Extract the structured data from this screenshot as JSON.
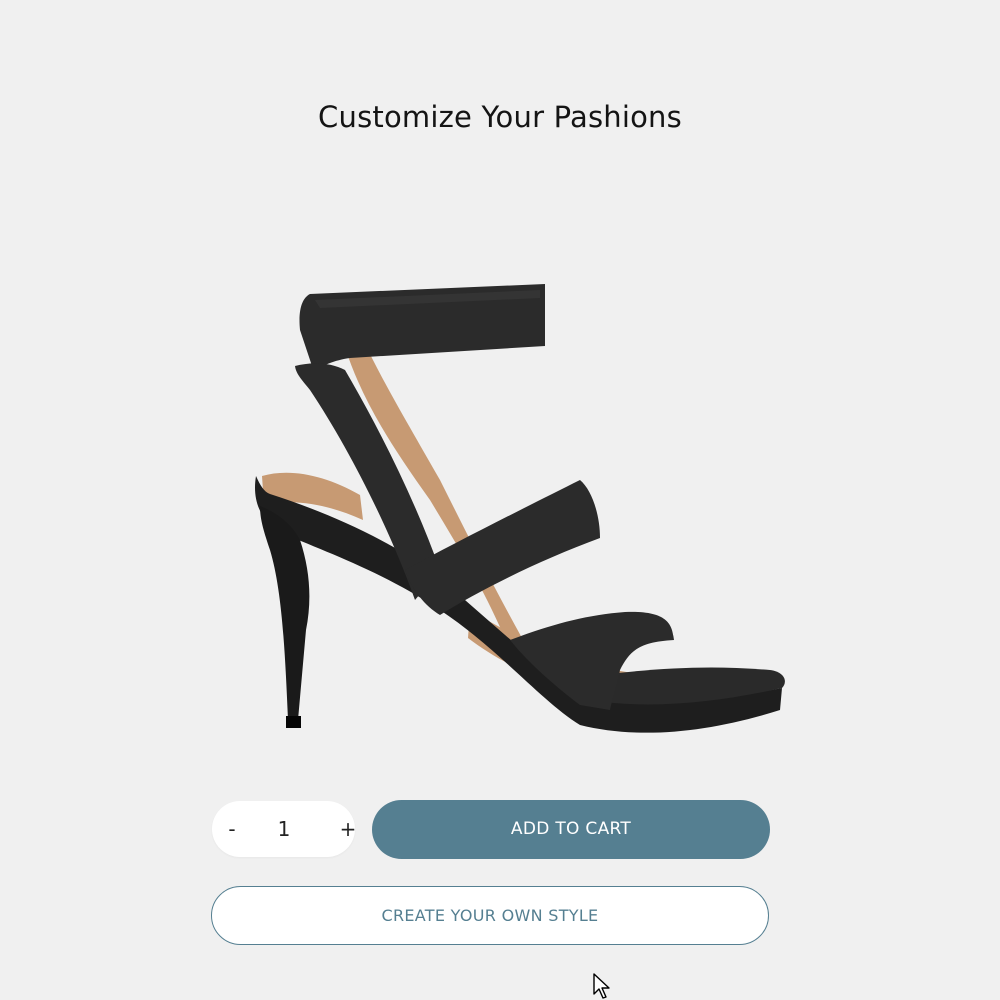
{
  "page": {
    "title": "Customize Your Pashions"
  },
  "product": {
    "image_icon": "high-heel-sandal-image"
  },
  "quantity": {
    "decrement_label": "-",
    "value": "1",
    "increment_label": "+"
  },
  "actions": {
    "add_to_cart_label": "ADD TO CART",
    "create_style_label": "CREATE YOUR OWN STYLE"
  },
  "colors": {
    "accent": "#557f91",
    "background": "#f0f0f0",
    "shoe": "#2b2b2b",
    "insole": "#c79a73"
  }
}
